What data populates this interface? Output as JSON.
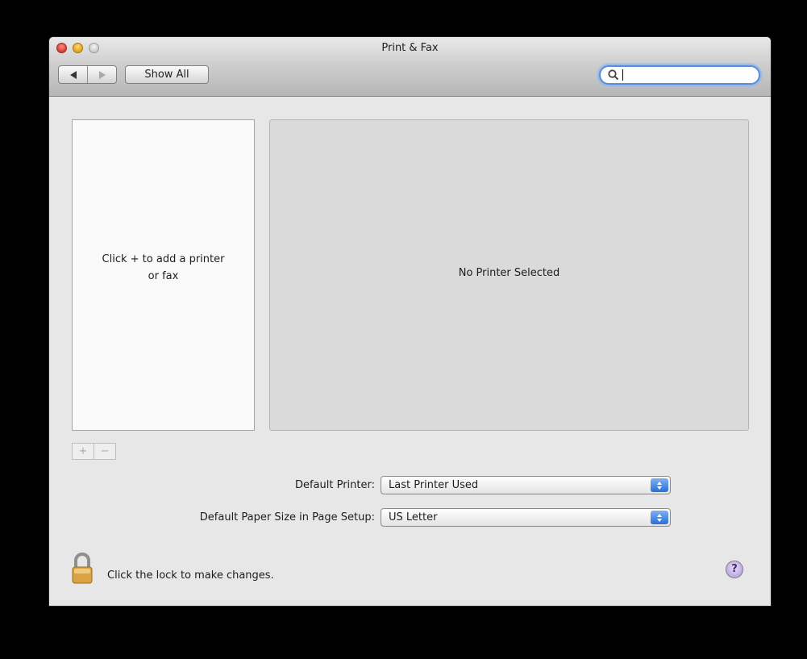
{
  "window": {
    "title": "Print & Fax"
  },
  "toolbar": {
    "back_icon": "back-arrow-icon",
    "forward_icon": "forward-arrow-icon",
    "show_all_label": "Show All",
    "search": {
      "value": "",
      "placeholder": "",
      "icon": "search-icon"
    }
  },
  "printers": {
    "empty_message": "Click + to add a printer or fax",
    "add_label": "+",
    "remove_label": "−"
  },
  "detail": {
    "message": "No Printer Selected"
  },
  "settings": {
    "default_printer_label": "Default Printer:",
    "default_printer_value": "Last Printer Used",
    "paper_size_label": "Default Paper Size in Page Setup:",
    "paper_size_value": "US Letter"
  },
  "footer": {
    "lock_icon": "lock-icon",
    "lock_message": "Click the lock to make changes.",
    "help_label": "?"
  },
  "colors": {
    "window_bg": "#e7e7e7",
    "search_focus": "#5b8ed8",
    "popup_arrow": "#2a6fd9",
    "help_button": "#b9a4e3",
    "lock_gold": "#d9a245"
  }
}
